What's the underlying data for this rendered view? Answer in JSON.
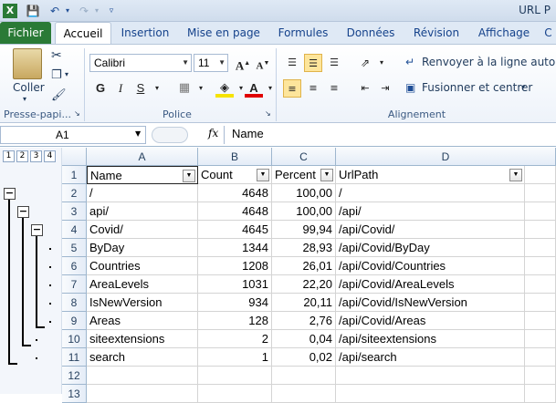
{
  "window": {
    "title": "URL P"
  },
  "tabs": [
    {
      "label": "Fichier"
    },
    {
      "label": "Accueil"
    },
    {
      "label": "Insertion"
    },
    {
      "label": "Mise en page"
    },
    {
      "label": "Formules"
    },
    {
      "label": "Données"
    },
    {
      "label": "Révision"
    },
    {
      "label": "Affichage"
    },
    {
      "label": "C"
    }
  ],
  "ribbon": {
    "clipboard": {
      "paste_label": "Coller",
      "group_label": "Presse-papi..."
    },
    "font": {
      "name": "Calibri",
      "size": "11",
      "group_label": "Police",
      "bold": "G",
      "italic": "I",
      "underline": "S"
    },
    "alignment": {
      "wrap_label": "Renvoyer à la ligne automati",
      "merge_label": "Fusionner et centrer",
      "group_label": "Alignement"
    }
  },
  "formula_bar": {
    "name_box": "A1",
    "fx": "fx",
    "content": "Name"
  },
  "outline_levels": [
    "1",
    "2",
    "3",
    "4"
  ],
  "columns": [
    "A",
    "B",
    "C",
    "D"
  ],
  "header_row": {
    "row": "1",
    "cells": [
      "Name",
      "Count",
      "Percent",
      "UrlPath"
    ]
  },
  "rows": [
    {
      "row": "2",
      "name": "/",
      "count": "4648",
      "percent": "100,00",
      "url": "/"
    },
    {
      "row": "3",
      "name": "api/",
      "count": "4648",
      "percent": "100,00",
      "url": "/api/"
    },
    {
      "row": "4",
      "name": "Covid/",
      "count": "4645",
      "percent": "99,94",
      "url": "/api/Covid/"
    },
    {
      "row": "5",
      "name": "ByDay",
      "count": "1344",
      "percent": "28,93",
      "url": "/api/Covid/ByDay"
    },
    {
      "row": "6",
      "name": "Countries",
      "count": "1208",
      "percent": "26,01",
      "url": "/api/Covid/Countries"
    },
    {
      "row": "7",
      "name": "AreaLevels",
      "count": "1031",
      "percent": "22,20",
      "url": "/api/Covid/AreaLevels"
    },
    {
      "row": "8",
      "name": "IsNewVersion",
      "count": "934",
      "percent": "20,11",
      "url": "/api/Covid/IsNewVersion"
    },
    {
      "row": "9",
      "name": "Areas",
      "count": "128",
      "percent": "2,76",
      "url": "/api/Covid/Areas"
    },
    {
      "row": "10",
      "name": "siteextensions",
      "count": "2",
      "percent": "0,04",
      "url": "/api/siteextensions"
    },
    {
      "row": "11",
      "name": "search",
      "count": "1",
      "percent": "0,02",
      "url": "/api/search"
    },
    {
      "row": "12",
      "name": "",
      "count": "",
      "percent": "",
      "url": ""
    },
    {
      "row": "13",
      "name": "",
      "count": "",
      "percent": "",
      "url": ""
    }
  ]
}
